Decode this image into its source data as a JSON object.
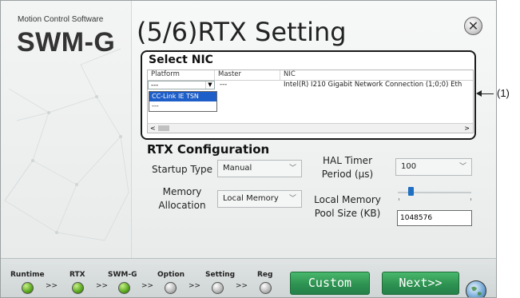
{
  "brand": {
    "subtitle": "Motion Control Software",
    "name": "SWM-G"
  },
  "page": {
    "title": "(5/6)RTX Setting"
  },
  "icons": {
    "close": "close-icon",
    "help": "globe-icon"
  },
  "nic_section": {
    "title": "Select NIC",
    "columns": [
      "Platform",
      "Master",
      "NIC"
    ],
    "row": {
      "platform": "---",
      "master": "---",
      "nic": "Intel(R) I210 Gigabit Network Connection (1;0;0) Eth"
    },
    "dropdown_options": [
      "CC-Link IE TSN",
      "---"
    ],
    "dropdown_selected_index": 0
  },
  "rtx_config": {
    "title": "RTX Configuration",
    "startup_type_label": "Startup Type",
    "startup_type_value": "Manual",
    "memory_alloc_label_1": "Memory",
    "memory_alloc_label_2": "Allocation",
    "memory_alloc_value": "Local Memory",
    "hal_timer_label_1": "HAL Timer",
    "hal_timer_label_2": "Period (µs)",
    "hal_timer_value": "100",
    "pool_size_label_1": "Local Memory",
    "pool_size_label_2": "Pool Size (KB)",
    "pool_size_value": "1048576"
  },
  "footer": {
    "steps": [
      {
        "label": "Runtime",
        "status": "green"
      },
      {
        "label": "RTX",
        "status": "green"
      },
      {
        "label": "SWM-G",
        "status": "green"
      },
      {
        "label": "Option",
        "status": "gray"
      },
      {
        "label": "Setting",
        "status": "gray"
      },
      {
        "label": "Reg",
        "status": "gray"
      }
    ],
    "separator": ">>",
    "custom_button": "Custom",
    "next_button": "Next>>"
  },
  "callout": {
    "label": "(1)"
  },
  "colors": {
    "accent_button": "#2e9251",
    "selection": "#1e5ec8",
    "slider": "#1f6fc2"
  }
}
